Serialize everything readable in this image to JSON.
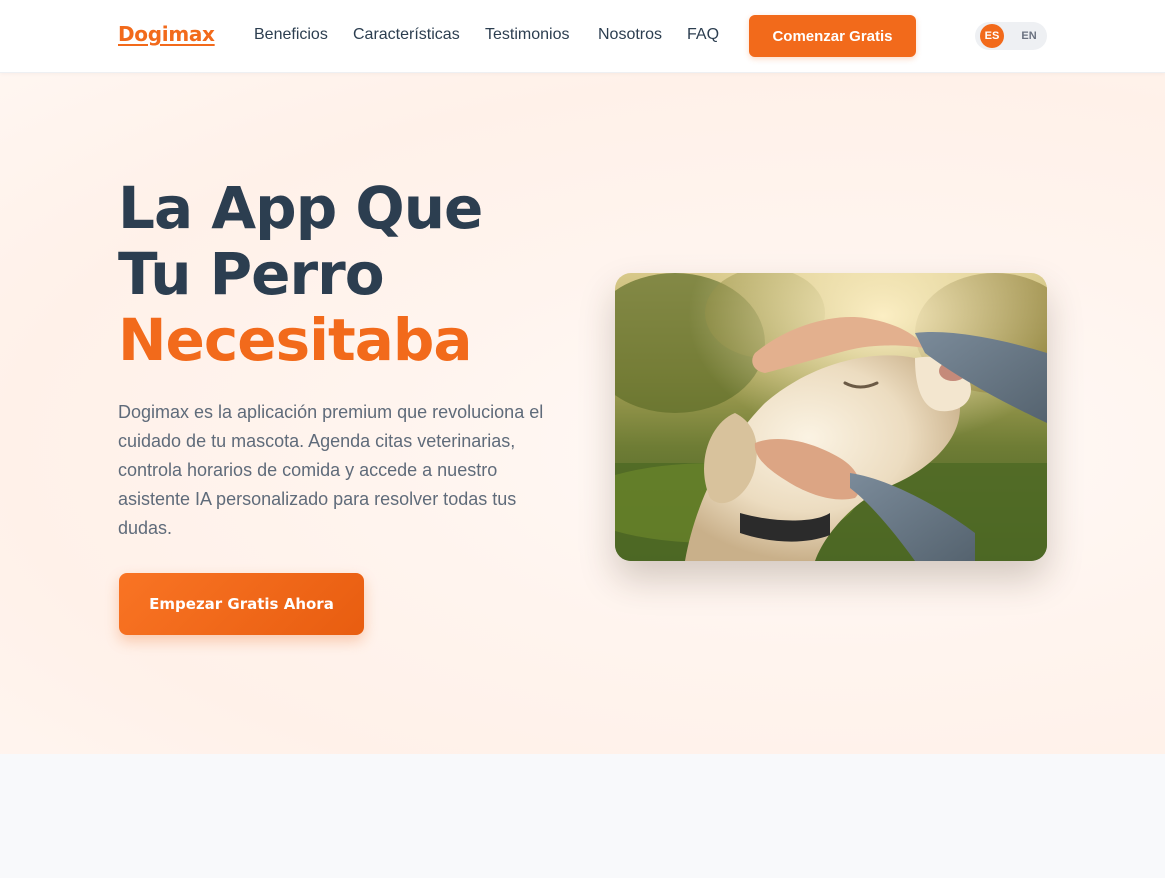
{
  "header": {
    "logo": "Dogimax",
    "nav": [
      "Beneficios",
      "Características",
      "Testimonios",
      "Nosotros",
      "FAQ"
    ],
    "cta": "Comenzar Gratis",
    "lang": {
      "active": "ES",
      "inactive": "EN"
    }
  },
  "hero": {
    "title_line1": "La App Que",
    "title_line2": "Tu Perro",
    "title_accent": "Necesitaba",
    "description": "Dogimax es la aplicación premium que revoluciona el cuidado de tu mascota. Agenda citas veterinarias, controla horarios de comida y accede a nuestro asistente IA personalizado para resolver todas tus dudas.",
    "cta": "Empezar Gratis Ahora",
    "image_icon": "dog-photo-icon"
  },
  "colors": {
    "accent": "#f26a1b",
    "heading": "#2c3e50",
    "text": "#5f6b7a",
    "hero_bg": "#fff4ee"
  }
}
